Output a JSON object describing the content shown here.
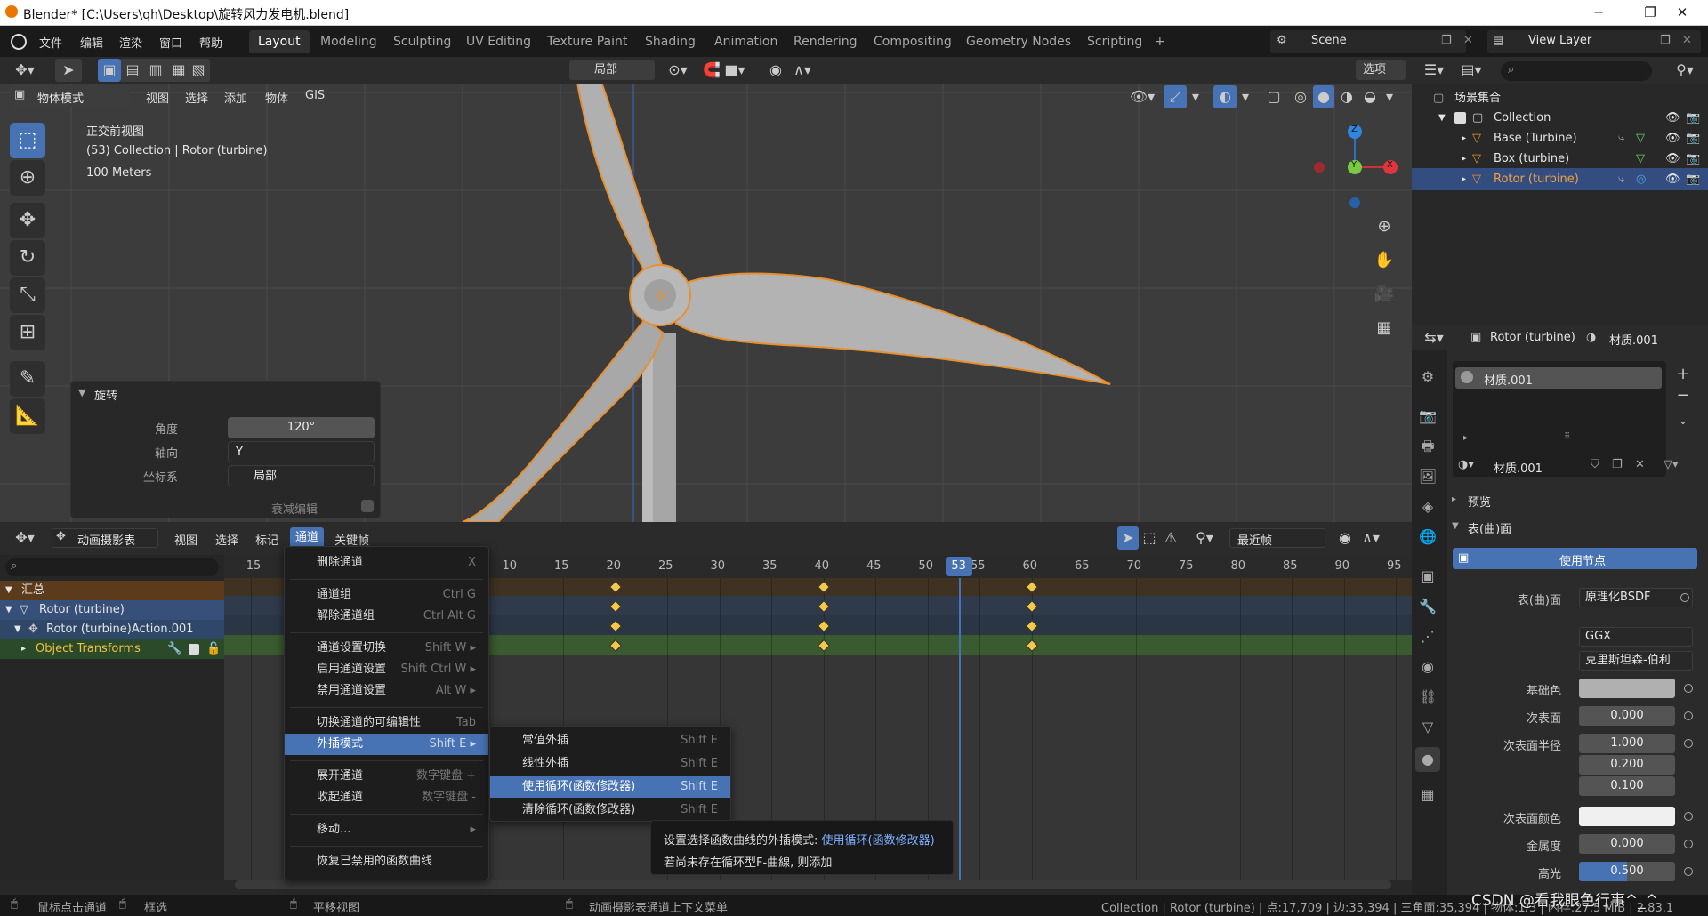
{
  "window": {
    "title": "Blender* [C:\\Users\\qh\\Desktop\\旋转风力发电机.blend]",
    "min": "─",
    "max": "❐",
    "close": "✕"
  },
  "menubar": [
    "文件",
    "编辑",
    "渲染",
    "窗口",
    "帮助"
  ],
  "workspaces": [
    "Layout",
    "Modeling",
    "Sculpting",
    "UV Editing",
    "Texture Paint",
    "Shading",
    "Animation",
    "Rendering",
    "Compositing",
    "Geometry Nodes",
    "Scripting",
    "+"
  ],
  "scene": "Scene",
  "view_layer": "View Layer",
  "viewport": {
    "transform_orient": "局部",
    "options": "选项",
    "mode": "物体模式",
    "menus": [
      "视图",
      "选择",
      "添加",
      "物体",
      "GIS"
    ],
    "view_name": "正交前视图",
    "collection_line": "(53) Collection | Rotor (turbine)",
    "scale": "100 Meters",
    "gizmo": {
      "z": "Z",
      "y": "Y",
      "x": "X"
    }
  },
  "redo_panel": {
    "title": "旋转",
    "angle_label": "角度",
    "angle": "120°",
    "axis_label": "轴向",
    "axis": "Y",
    "orient_label": "坐标系",
    "orient": "局部",
    "prop_label": "衰减编辑"
  },
  "outliner": {
    "scene_collection": "场景集合",
    "items": [
      "Collection",
      "Base (Turbine)",
      "Box (turbine)",
      "Rotor (turbine)"
    ]
  },
  "props": {
    "object": "Rotor (turbine)",
    "material_header": "材质.001",
    "slot": "材质.001",
    "material": "材质.001",
    "preview": "预览",
    "surface": "表(曲)面",
    "use_nodes": "使用节点",
    "rows": [
      {
        "label": "表(曲)面",
        "value": "原理化BSDF"
      },
      {
        "label": "",
        "value": "GGX"
      },
      {
        "label": "",
        "value": "克里斯坦森-伯利"
      },
      {
        "label": "基础色",
        "value": ""
      },
      {
        "label": "次表面",
        "value": "0.000"
      },
      {
        "label": "次表面半径",
        "value": "1.000"
      },
      {
        "label": "",
        "value": "0.200"
      },
      {
        "label": "",
        "value": "0.100"
      },
      {
        "label": "次表面颜色",
        "value": ""
      },
      {
        "label": "金属度",
        "value": "0.000"
      },
      {
        "label": "高光",
        "value": "0.500"
      }
    ]
  },
  "timeline": {
    "editor": "动画摄影表",
    "menus": [
      "视图",
      "选择",
      "标记",
      "通道",
      "关键帧"
    ],
    "snap": "最近帧",
    "ruler": [
      "-15",
      "10",
      "15",
      "20",
      "25",
      "30",
      "35",
      "40",
      "45",
      "50",
      "55",
      "60",
      "65",
      "70",
      "75",
      "80",
      "85",
      "90",
      "95"
    ],
    "current_frame": "53",
    "channels": [
      "汇总",
      "Rotor (turbine)",
      "Rotor (turbine)Action.001",
      "Object Transforms"
    ],
    "keyframes": [
      20,
      40,
      60
    ]
  },
  "channel_menu": {
    "items": [
      {
        "label": "删除通道",
        "sc": "X"
      },
      {
        "label": "通道组",
        "sc": "Ctrl G"
      },
      {
        "label": "解除通道组",
        "sc": "Ctrl Alt G"
      },
      {
        "label": "通道设置切换",
        "sc": "Shift W ▸"
      },
      {
        "label": "启用通道设置",
        "sc": "Shift Ctrl W ▸"
      },
      {
        "label": "禁用通道设置",
        "sc": "Alt W ▸"
      },
      {
        "label": "切换通道的可编辑性",
        "sc": "Tab"
      },
      {
        "label": "外插模式",
        "sc": "Shift E ▸"
      },
      {
        "label": "展开通道",
        "sc": "数字键盘 +"
      },
      {
        "label": "收起通道",
        "sc": "数字键盘 -"
      },
      {
        "label": "移动...",
        "sc": "▸"
      },
      {
        "label": "恢复已禁用的函数曲线",
        "sc": ""
      }
    ]
  },
  "extrapolation_menu": {
    "items": [
      {
        "label": "常值外插",
        "sc": "Shift E"
      },
      {
        "label": "线性外插",
        "sc": "Shift E"
      },
      {
        "label": "使用循环(函数修改器)",
        "sc": "Shift E"
      },
      {
        "label": "清除循环(函数修改器)",
        "sc": "Shift E"
      }
    ]
  },
  "tooltip": {
    "line1_prefix": "设置选择函数曲线的外插模式: ",
    "line1_value": "使用循环(函数修改器)",
    "line2": "若尚未存在循环型F-曲線, 则添加"
  },
  "status": {
    "left1": "鼠标点击通道",
    "left2": "框选",
    "mid1": "平移视图",
    "mid2": "动画摄影表通道上下文菜单",
    "right": "Collection | Rotor (turbine) | 点:17,709 | 边:35,394 | 三角面:35,394 | 物体:1/3 | 内存:27.5 MiB | 2.83.1",
    "watermark": "CSDN @看我眼色行事^_^"
  }
}
